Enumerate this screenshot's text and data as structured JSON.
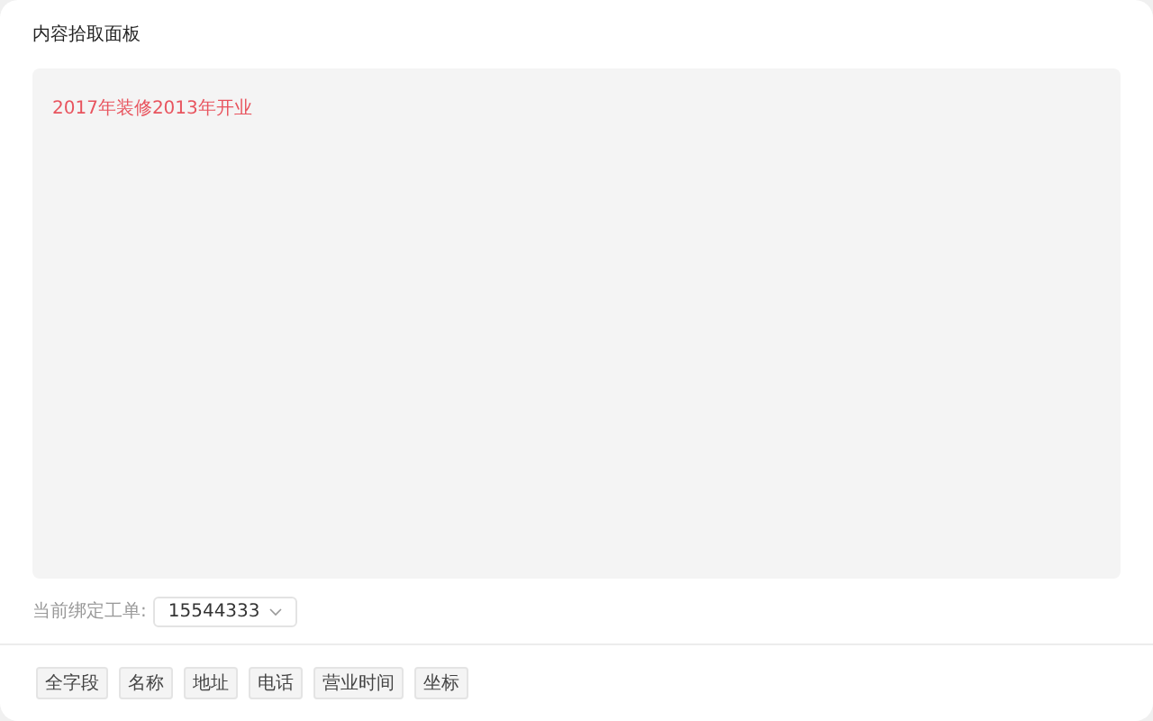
{
  "title": "内容拾取面板",
  "content": {
    "text": "2017年装修2013年开业"
  },
  "binding": {
    "label": "当前绑定工单:",
    "value": "15544333"
  },
  "tags": [
    {
      "label": "全字段"
    },
    {
      "label": "名称"
    },
    {
      "label": "地址"
    },
    {
      "label": "电话"
    },
    {
      "label": "营业时间"
    },
    {
      "label": "坐标"
    }
  ]
}
